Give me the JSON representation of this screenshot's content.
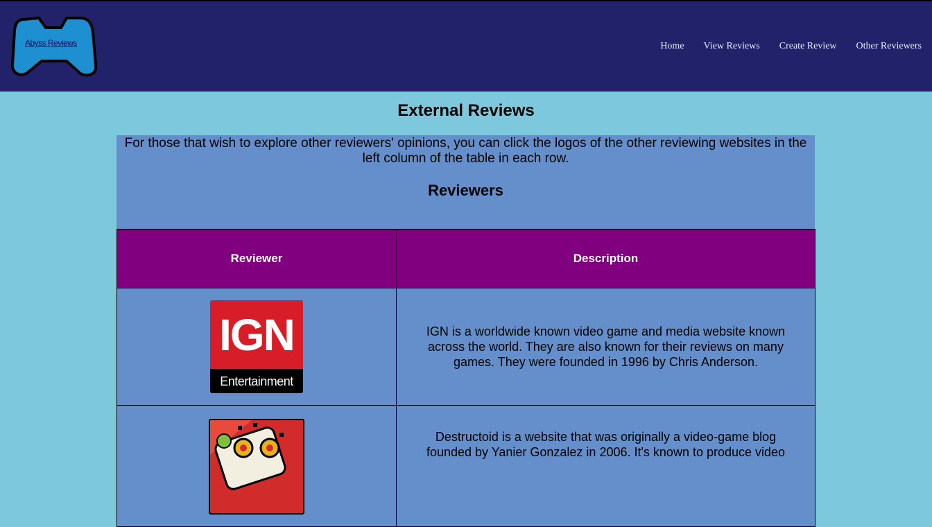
{
  "header": {
    "logo_text": "Abyss Reviews",
    "nav": [
      {
        "label": "Home"
      },
      {
        "label": "View Reviews"
      },
      {
        "label": "Create Review"
      },
      {
        "label": "Other Reviewers"
      }
    ]
  },
  "page": {
    "title": "External Reviews",
    "intro": "For those that wish to explore other reviewers' opinions, you can click the logos of the other reviewing websites in the left column of the table in each row.",
    "subtitle": "Reviewers"
  },
  "table": {
    "headers": [
      "Reviewer",
      "Description"
    ],
    "rows": [
      {
        "logo_main": "IGN",
        "logo_sub": "Entertainment",
        "logo_icon": "ign-logo",
        "description": "IGN is a worldwide known video game and media website known across the world. They are also known for their reviews on many games. They were founded in 1996 by Chris Anderson."
      },
      {
        "logo_icon": "destructoid-logo",
        "description": "Destructoid is a website that was originally a video-game blog founded by Yanier Gonzalez in 2006. It's known to produce video"
      }
    ]
  },
  "colors": {
    "header_bg": "#22226a",
    "page_bg": "#7ec8de",
    "content_bg": "#648fcb",
    "table_header_bg": "#800080",
    "ign_red": "#d71e28"
  }
}
